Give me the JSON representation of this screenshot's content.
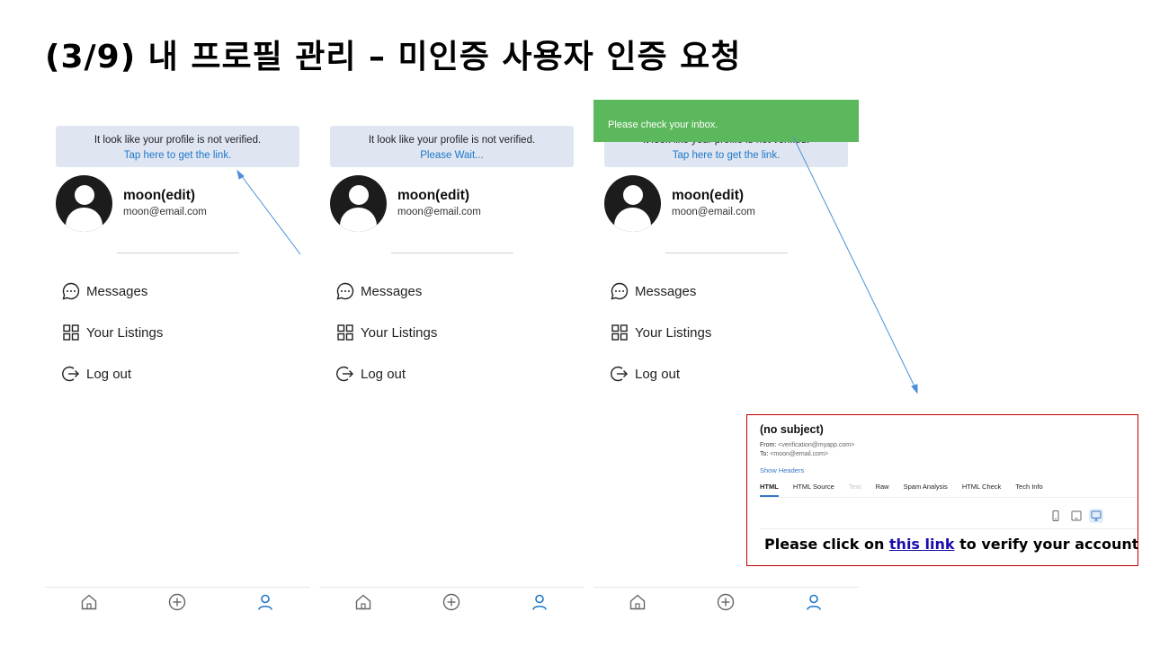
{
  "slide": {
    "title": "(3/9) 내 프로필 관리 – 미인증 사용자 인증 요청"
  },
  "screens": [
    {
      "banner_line1": "It look like your profile is not verified.",
      "banner_line2": "Tap here to get the link."
    },
    {
      "banner_line1": "It look like your profile is not verified.",
      "banner_line2": "Please Wait..."
    },
    {
      "banner_line1": "It look like your profile is not verified.",
      "banner_line2": "Tap here to get the link."
    }
  ],
  "profile": {
    "name": "moon(edit)",
    "email": "moon@email.com"
  },
  "menu": {
    "messages": "Messages",
    "listings": "Your Listings",
    "logout": "Log out"
  },
  "icons": {
    "messages": "chat-bubble-icon",
    "listings": "grid-icon",
    "logout": "logout-icon",
    "home": "home-icon",
    "add": "add-circle-icon",
    "profile": "person-icon"
  },
  "colors": {
    "link_blue": "#1f77c7",
    "banner_bg": "#dfe6f2",
    "toast_bg": "#5cb85c",
    "highlight_border": "#c00000",
    "annotation_arrow": "#4a90d9"
  },
  "toast": {
    "message": "Please check your inbox."
  },
  "email": {
    "subject": "(no subject)",
    "from_label": "From:",
    "from_addr": "<verification@myapp.com>",
    "to_label": "To:",
    "to_addr": "<moon@email.com>",
    "show_headers": "Show Headers",
    "tabs": [
      "HTML",
      "HTML Source",
      "Text",
      "Raw",
      "Spam Analysis",
      "HTML Check",
      "Tech Info"
    ],
    "body_before": "Please click on ",
    "body_link": "this link",
    "body_after": " to verify your account."
  }
}
